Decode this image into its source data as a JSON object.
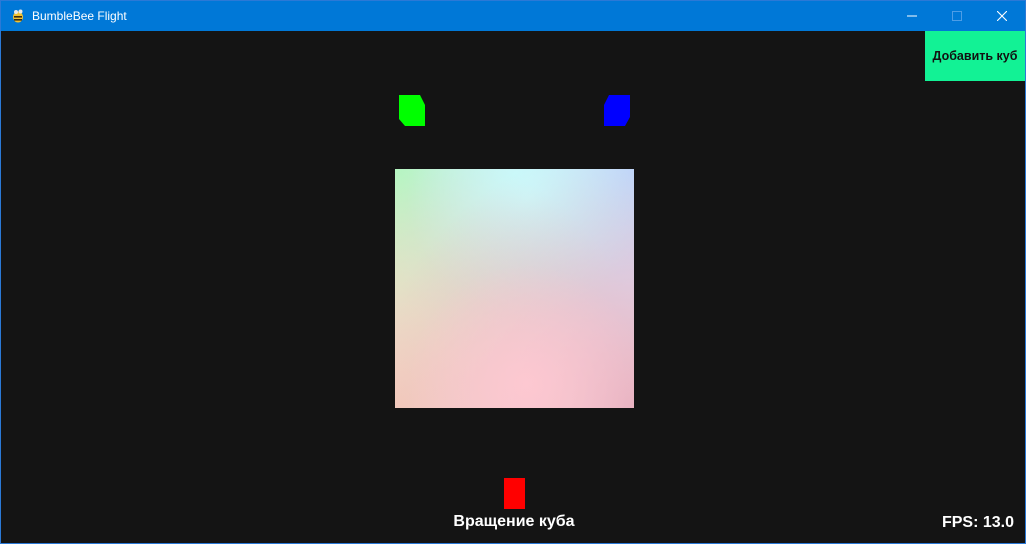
{
  "window": {
    "title": "BumbleBee Flight",
    "app_icon": "bumblebee-icon",
    "controls": [
      "minimize-icon",
      "maximize-icon",
      "close-icon"
    ]
  },
  "toolbar": {
    "add_cube_label": "Добавить куб"
  },
  "scene": {
    "cubes": [
      {
        "color": "#00ff00",
        "name": "green-cube"
      },
      {
        "color": "#0000ff",
        "name": "blue-cube"
      },
      {
        "color": "#ff0000",
        "name": "red-cube"
      }
    ],
    "main_cube_colors": [
      "#c8ffd2",
      "#d9ffff",
      "#c8dcff",
      "#ffffee",
      "#ffe6ee",
      "#f5c8d2",
      "#ffd8c8"
    ]
  },
  "status": {
    "rotation_label": "Вращение куба",
    "fps_label": "FPS:",
    "fps_value": "13.0"
  },
  "colors": {
    "titlebar": "#0078d7",
    "background": "#141414",
    "button": "#12f295"
  }
}
